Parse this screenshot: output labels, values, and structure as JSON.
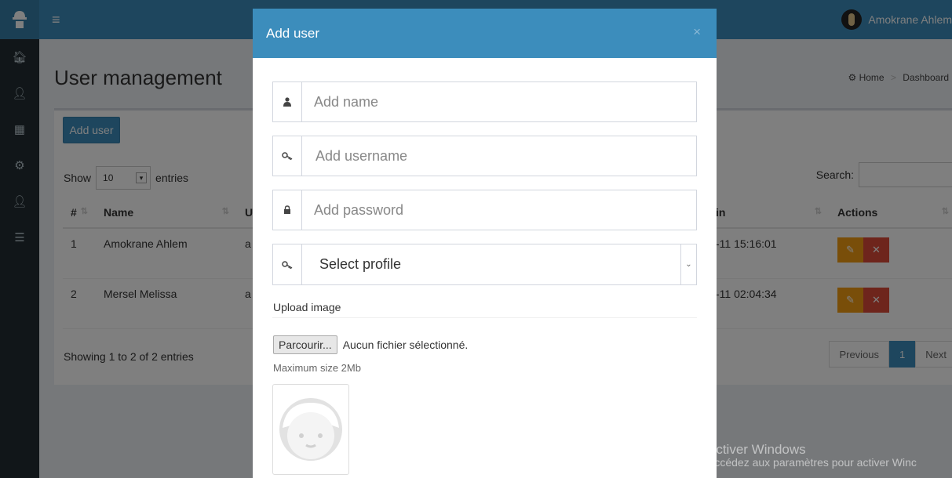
{
  "header": {
    "user_name": "Amokrane Ahlem"
  },
  "page": {
    "title": "User management",
    "breadcrumb": [
      "Home",
      "Dashboard"
    ]
  },
  "toolbar": {
    "add_user_label": "Add user"
  },
  "datatable": {
    "show_label": "Show",
    "entries_value": "10",
    "entries_label": "entries",
    "search_label": "Search:",
    "columns": [
      "#",
      "Name",
      "U",
      "in",
      "Actions"
    ],
    "rows": [
      {
        "id": "1",
        "name": "Amokrane Ahlem",
        "login_col_prefix": "a",
        "last_login": "-11 15:16:01"
      },
      {
        "id": "2",
        "name": "Mersel Melissa",
        "login_col_prefix": "a",
        "last_login": "-11 02:04:34"
      }
    ],
    "info": "Showing 1 to 2 of 2 entries",
    "pagination": {
      "previous": "Previous",
      "current": "1",
      "next": "Next"
    }
  },
  "modal": {
    "title": "Add user",
    "close_symbol": "×",
    "name_placeholder": "Add name",
    "username_placeholder": "Add username",
    "password_placeholder": "Add password",
    "profile_placeholder": "Select profile",
    "upload_label": "Upload image",
    "file_button": "Parcourir...",
    "file_status": "Aucun fichier sélectionné.",
    "max_size": "Maximum size 2Mb"
  },
  "watermark": {
    "line1": "Activer Windows",
    "line2": "Accédez aux paramètres pour activer Winc"
  },
  "icons": {
    "sidebar": [
      "logo-icon",
      "home-icon",
      "user-icon",
      "grid-icon",
      "settings-icon",
      "user-icon",
      "list-icon"
    ],
    "field_name": "user-icon",
    "field_username": "key-icon",
    "field_password": "lock-icon",
    "field_profile": "key-icon"
  },
  "colors": {
    "primary": "#3c8dbc",
    "warning": "#f39c12",
    "danger": "#dd4b39",
    "sidebar": "#222d32"
  }
}
